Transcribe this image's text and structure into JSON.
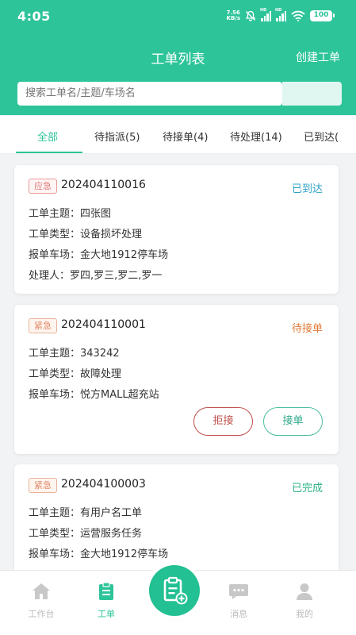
{
  "status_bar": {
    "time": "4:05",
    "net_speed_value": "7.56",
    "net_speed_unit": "KB/s",
    "signal1_label": "HD",
    "signal2_label": "HD",
    "battery": "100"
  },
  "header": {
    "title": "工单列表",
    "create_label": "创建工单",
    "search_placeholder": "搜索工单名/主题/车场名"
  },
  "tabs": [
    {
      "label": "全部",
      "active": true
    },
    {
      "label": "待指派(5)"
    },
    {
      "label": "待接单(4)"
    },
    {
      "label": "待处理(14)"
    },
    {
      "label": "已到达("
    }
  ],
  "cards": [
    {
      "badge": "应急",
      "order_no": "202404110016",
      "status": "已到达",
      "status_color": "#2ea3c7",
      "rows": [
        {
          "label": "工单主题：",
          "value": "四张图"
        },
        {
          "label": "工单类型：",
          "value": "设备损坏处理"
        },
        {
          "label": "报单车场：",
          "value": "金大地1912停车场"
        },
        {
          "label": "处理人：",
          "value": "罗四,罗三,罗二,罗一"
        }
      ]
    },
    {
      "badge": "紧急",
      "order_no": "202404110001",
      "status": "待接单",
      "status_color": "#e07b39",
      "rows": [
        {
          "label": "工单主题：",
          "value": "343242"
        },
        {
          "label": "工单类型：",
          "value": "故障处理"
        },
        {
          "label": "报单车场：",
          "value": "悦方MALL超充站"
        }
      ],
      "reject_label": "拒接",
      "accept_label": "接单"
    },
    {
      "badge": "紧急",
      "order_no": "202404100003",
      "status": "已完成",
      "status_color": "#2eb38a",
      "rows": [
        {
          "label": "工单主题：",
          "value": "有用户名工单"
        },
        {
          "label": "工单类型：",
          "value": "运营服务任务"
        },
        {
          "label": "报单车场：",
          "value": "金大地1912停车场"
        }
      ]
    }
  ],
  "tabbar": {
    "items": [
      {
        "label": "工作台",
        "icon": "home-icon"
      },
      {
        "label": "工单",
        "icon": "clipboard-icon",
        "active": true
      },
      {
        "label": "消息",
        "icon": "chat-icon"
      },
      {
        "label": "我的",
        "icon": "user-icon"
      }
    ],
    "fab_icon": "add-clipboard-icon"
  },
  "colors": {
    "brand": "#2ec49a",
    "fab": "#22c093"
  }
}
